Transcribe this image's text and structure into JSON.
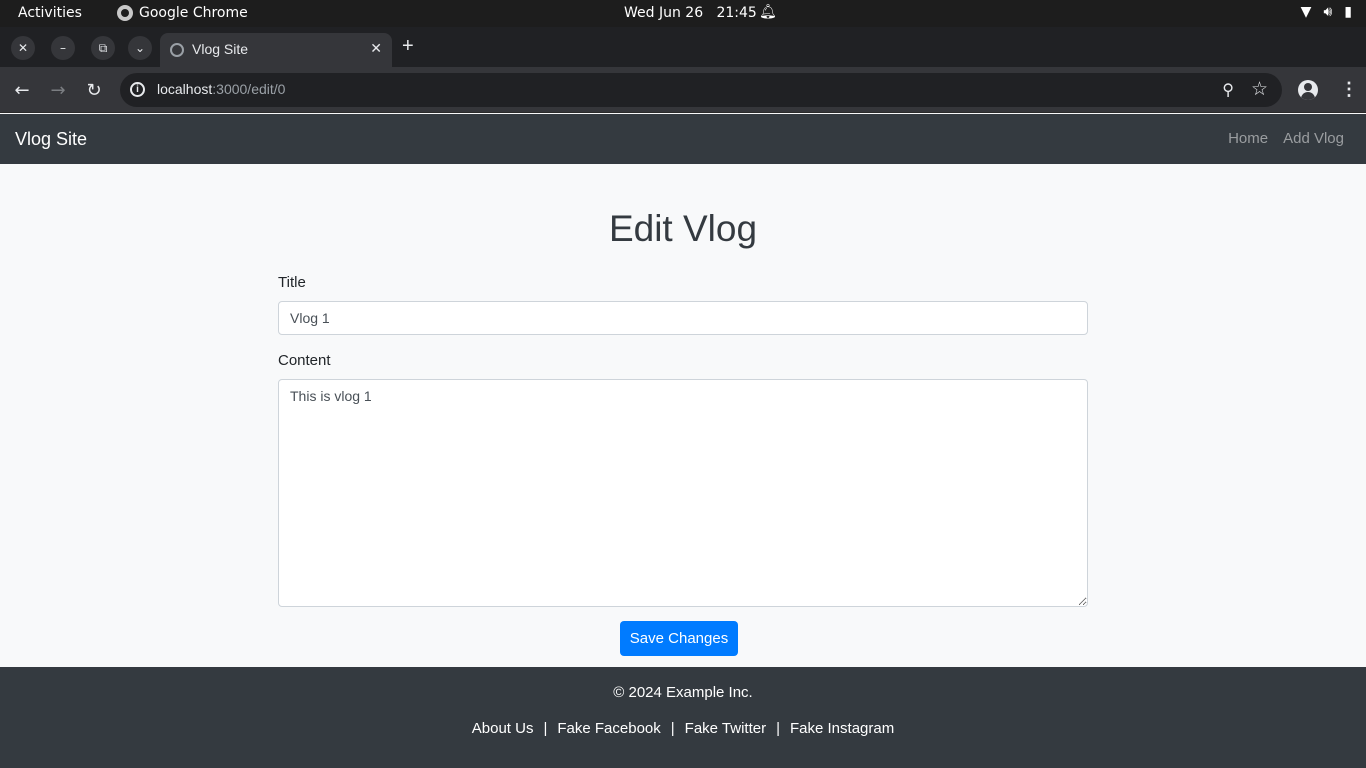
{
  "os": {
    "activities": "Activities",
    "app_name": "Google Chrome",
    "date": "Wed Jun 26",
    "time": "21:45"
  },
  "browser": {
    "tab_title": "Vlog Site",
    "url_host": "localhost",
    "url_path": ":3000/edit/0"
  },
  "navbar": {
    "brand": "Vlog Site",
    "links": [
      "Home",
      "Add Vlog"
    ]
  },
  "form": {
    "heading": "Edit Vlog",
    "title_label": "Title",
    "title_value": "Vlog 1",
    "content_label": "Content",
    "content_value": "This is vlog 1",
    "submit_label": "Save Changes"
  },
  "footer": {
    "copyright": "© 2024 Example Inc.",
    "links": [
      "About Us",
      "Fake Facebook",
      "Fake Twitter",
      "Fake Instagram"
    ],
    "separator": "|"
  },
  "colors": {
    "navbar_bg": "#343a40",
    "primary": "#007bff",
    "page_bg": "#f8f9fa"
  }
}
